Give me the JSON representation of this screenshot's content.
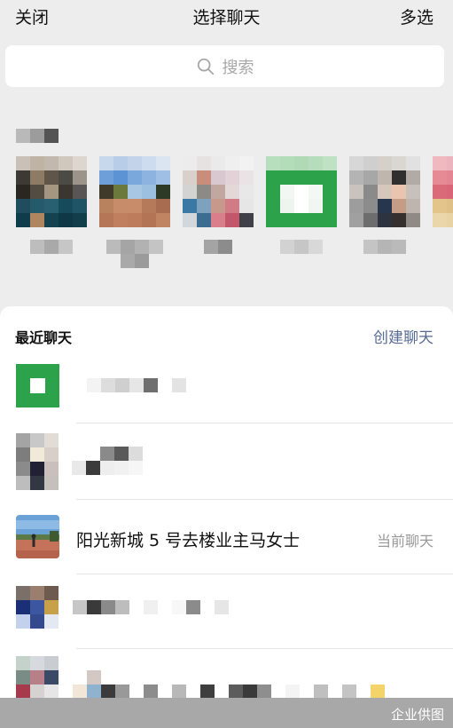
{
  "topbar": {
    "close_label": "关闭",
    "title": "选择聊天",
    "multi_select_label": "多选"
  },
  "search": {
    "placeholder": "搜索"
  },
  "recent_contacts_strip": {
    "tiles": [
      {
        "avatar": "pixelated-avatar-1"
      },
      {
        "avatar": "pixelated-avatar-2"
      },
      {
        "avatar": "pixelated-avatar-3"
      },
      {
        "avatar": "pixelated-avatar-4"
      },
      {
        "avatar": "pixelated-avatar-5"
      },
      {
        "avatar": "pixelated-avatar-6"
      }
    ]
  },
  "sheet": {
    "header": "最近聊天",
    "create_chat_label": "创建聊天",
    "rows": [
      {
        "kind": "pixelated"
      },
      {
        "kind": "pixelated"
      },
      {
        "kind": "current",
        "name": "阳光新城 5 号去楼业主马女士",
        "tag": "当前聊天"
      },
      {
        "kind": "pixelated"
      },
      {
        "kind": "pixelated"
      }
    ]
  },
  "footer": {
    "watermark": "企业供图"
  },
  "colors": {
    "accent_link": "#576b95",
    "background": "#ededed",
    "sheet": "#ffffff"
  }
}
